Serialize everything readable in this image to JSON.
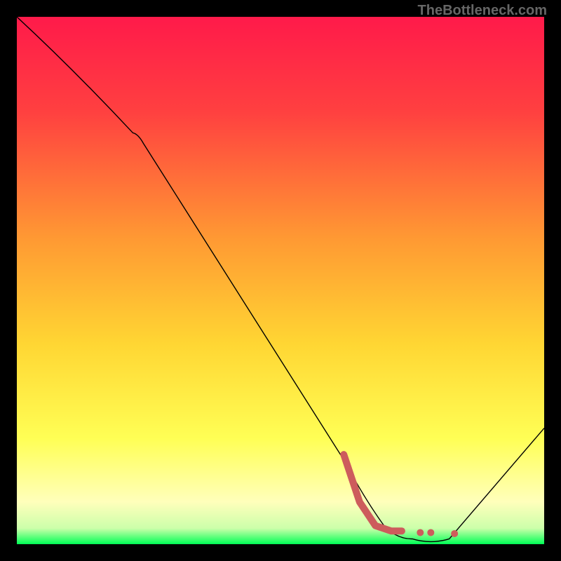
{
  "watermark": "TheBottleneck.com",
  "chart_data": {
    "type": "line",
    "title": "",
    "xlabel": "",
    "ylabel": "",
    "xlim": [
      0,
      100
    ],
    "ylim": [
      0,
      100
    ],
    "background_gradient": {
      "top": "#ff1a4a",
      "mid_upper": "#ff7a33",
      "mid": "#ffd633",
      "mid_lower": "#ffff66",
      "lower": "#ffffaa",
      "bottom": "#00ff55"
    },
    "series": [
      {
        "name": "curve",
        "color": "#000000",
        "stroke_width": 1.4,
        "points": [
          {
            "x": 0,
            "y": 100
          },
          {
            "x": 22,
            "y": 78
          },
          {
            "x": 24,
            "y": 76
          },
          {
            "x": 62,
            "y": 16
          },
          {
            "x": 70,
            "y": 3
          },
          {
            "x": 75,
            "y": 1
          },
          {
            "x": 82,
            "y": 1
          },
          {
            "x": 100,
            "y": 22
          }
        ]
      }
    ],
    "marker_path": {
      "name": "markers",
      "color": "#CD5C5C",
      "stroke_width": 10,
      "points": [
        {
          "x": 62,
          "y": 17
        },
        {
          "x": 65,
          "y": 8
        },
        {
          "x": 68,
          "y": 3.5
        },
        {
          "x": 71,
          "y": 2.5
        },
        {
          "x": 73,
          "y": 2.5
        }
      ],
      "dots": [
        {
          "x": 76.5,
          "y": 2.2
        },
        {
          "x": 78.5,
          "y": 2.2
        },
        {
          "x": 83,
          "y": 2.0
        }
      ]
    }
  }
}
